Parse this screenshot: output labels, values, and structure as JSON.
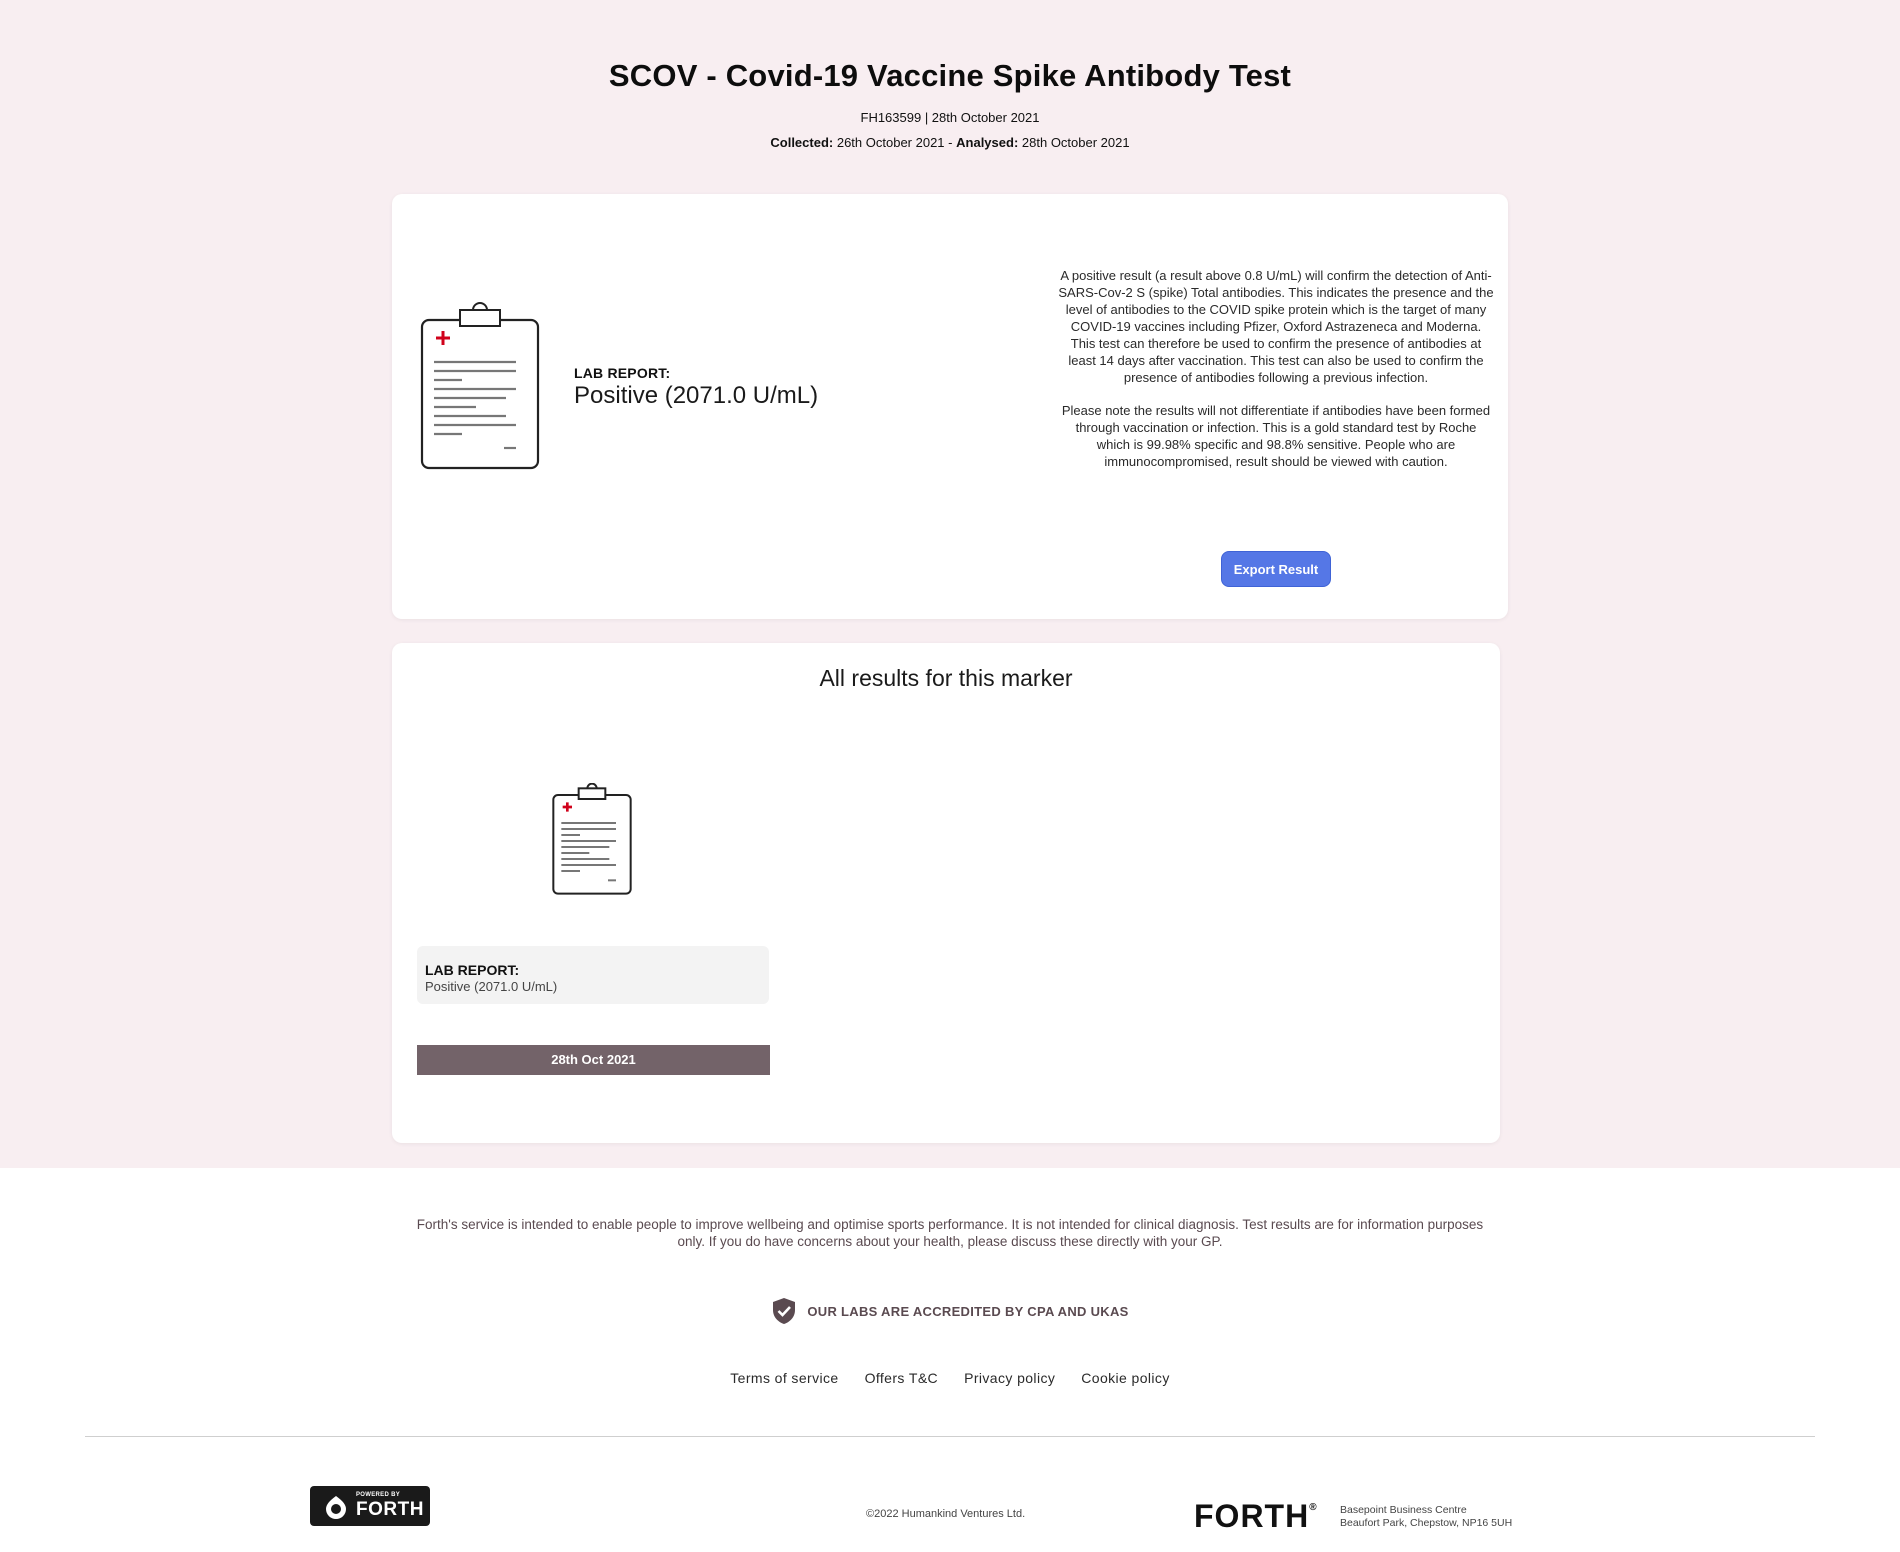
{
  "header": {
    "title": "SCOV - Covid-19 Vaccine Spike Antibody Test",
    "reference": "FH163599 | 28th October 2021",
    "collected_label": "Collected:",
    "collected_value": "26th October 2021",
    "separator": "-",
    "analysed_label": "Analysed:",
    "analysed_value": "28th October 2021"
  },
  "result_card": {
    "lab_report_label": "LAB REPORT:",
    "lab_report_value": "Positive (2071.0 U/mL)",
    "description_p1": "A positive result (a result above 0.8 U/mL) will confirm the detection of Anti-SARS-Cov-2 S (spike) Total antibodies. This indicates the presence and the level of antibodies to the COVID spike protein which is the target of many COVID-19 vaccines including Pfizer, Oxford Astrazeneca and Moderna. This test can therefore be used to confirm the presence of antibodies at least 14 days after vaccination. This test can also be used to confirm the presence of antibodies following a previous infection.",
    "description_p2": "Please note the results will not differentiate if antibodies have been formed through vaccination or infection.  This is a gold standard test by Roche which is 99.98% specific and 98.8% sensitive. People who are immunocompromised, result should be viewed with caution.",
    "export_label": "Export Result"
  },
  "history_card": {
    "title": "All results for this marker",
    "items": [
      {
        "lab_report_label": "LAB REPORT:",
        "lab_report_value": "Positive (2071.0 U/mL)",
        "date": "28th Oct 2021"
      }
    ]
  },
  "footer": {
    "disclaimer": "Forth's service is intended to enable people to improve wellbeing and optimise sports performance. It is not intended for clinical diagnosis. Test results are for information purposes only. If you do have concerns about your health, please discuss these directly with your GP.",
    "accreditation": "OUR LABS ARE ACCREDITED BY CPA AND UKAS",
    "links": [
      "Terms of service",
      "Offers T&C",
      "Privacy policy",
      "Cookie policy"
    ],
    "powered_by_small": "POWERED BY",
    "powered_by_brand": "FORTH",
    "copyright": "©2022 Humankind Ventures Ltd.",
    "brand_logo": "FORTH",
    "brand_registered": "®",
    "address_line1": "Basepoint Business Centre",
    "address_line2": "Beaufort Park, Chepstow, NP16 5UH"
  },
  "colors": {
    "page_background": "#f8eef1",
    "accent_button": "#5577e6",
    "date_bar": "#736369",
    "clipboard_cross": "#d0021b",
    "footer_text": "#5a4a50"
  },
  "icons": [
    "clipboard-report-icon",
    "shield-check-icon",
    "forth-drop-icon"
  ]
}
